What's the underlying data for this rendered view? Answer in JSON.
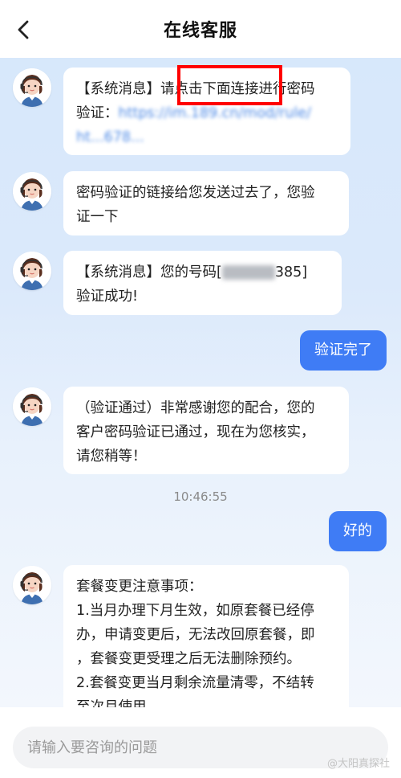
{
  "header": {
    "title": "在线客服"
  },
  "messages": {
    "m1": {
      "line1": "【系统消息】请点击下面连接进行密码",
      "line2": "验证：",
      "link1": "https://im.189.cn/mod/rule/",
      "link2": "ht...678..."
    },
    "m2": {
      "line1": "密码验证的链接给您发送过去了，您验",
      "line2": "证一下"
    },
    "m3": {
      "line1_a": "【系统消息】您的号码[",
      "line1_b": "385]",
      "line2": "验证成功!"
    },
    "m4": {
      "text": "验证完了"
    },
    "m5": {
      "line1": "（验证通过）非常感谢您的配合，您的",
      "line2": "客户密码验证已通过，现在为您核实，",
      "line3": "请您稍等！"
    },
    "m6": {
      "text": "好的"
    },
    "m7": {
      "line1": "套餐变更注意事项：",
      "line2": "1.当月办理下月生效，如原套餐已经停",
      "line3": "办，申请变更后，无法改回原套餐，即",
      "line4": "，套餐变更受理之后无法删除预约。",
      "line5": "2.套餐变更当月剩余流量清零，不结转",
      "line6": "至次月使用"
    }
  },
  "timestamp": "10:46:55",
  "input": {
    "placeholder": "请输入要咨询的问题"
  },
  "watermark": "@大阳真探社",
  "colors": {
    "accent": "#3f7cf5",
    "highlight": "#ff0000",
    "chat_bg": "#d7e8fb"
  }
}
